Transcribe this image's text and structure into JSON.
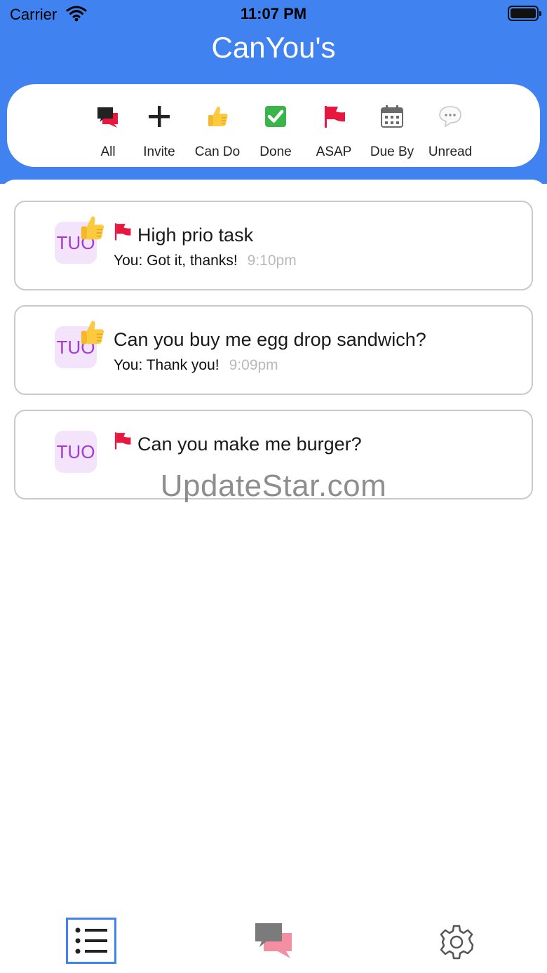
{
  "status_bar": {
    "carrier": "Carrier",
    "time": "11:07 PM"
  },
  "app": {
    "title": "CanYou's"
  },
  "filters": [
    {
      "label": "All",
      "icon": "chat-bubbles-icon"
    },
    {
      "label": "Invite",
      "icon": "plus-icon"
    },
    {
      "label": "Can Do",
      "icon": "thumbs-up-icon"
    },
    {
      "label": "Done",
      "icon": "check-box-icon"
    },
    {
      "label": "ASAP",
      "icon": "red-flag-icon"
    },
    {
      "label": "Due By",
      "icon": "calendar-icon"
    },
    {
      "label": "Unread",
      "icon": "speech-bubble-icon"
    }
  ],
  "tasks": [
    {
      "avatar": "TUO",
      "title": "High prio task",
      "last_message": "You: Got it, thanks!",
      "time": "9:10pm",
      "can_do": true,
      "asap": true
    },
    {
      "avatar": "TUO",
      "title": "Can you buy me egg drop sandwich?",
      "last_message": "You: Thank you!",
      "time": "9:09pm",
      "can_do": true,
      "asap": false
    },
    {
      "avatar": "TUO",
      "title": "Can you make me burger?",
      "last_message": "",
      "time": "",
      "can_do": false,
      "asap": true
    }
  ],
  "watermark": "UpdateStar.com",
  "tabbar": {
    "tabs": [
      "list-icon",
      "chat-icon",
      "gear-icon"
    ],
    "active": "list-icon"
  },
  "colors": {
    "header": "#4083f0",
    "flag": "#e8173f",
    "avatar_bg": "#f3e3fb",
    "avatar_text": "#a23bd2",
    "card_border": "#c9c9c9"
  }
}
